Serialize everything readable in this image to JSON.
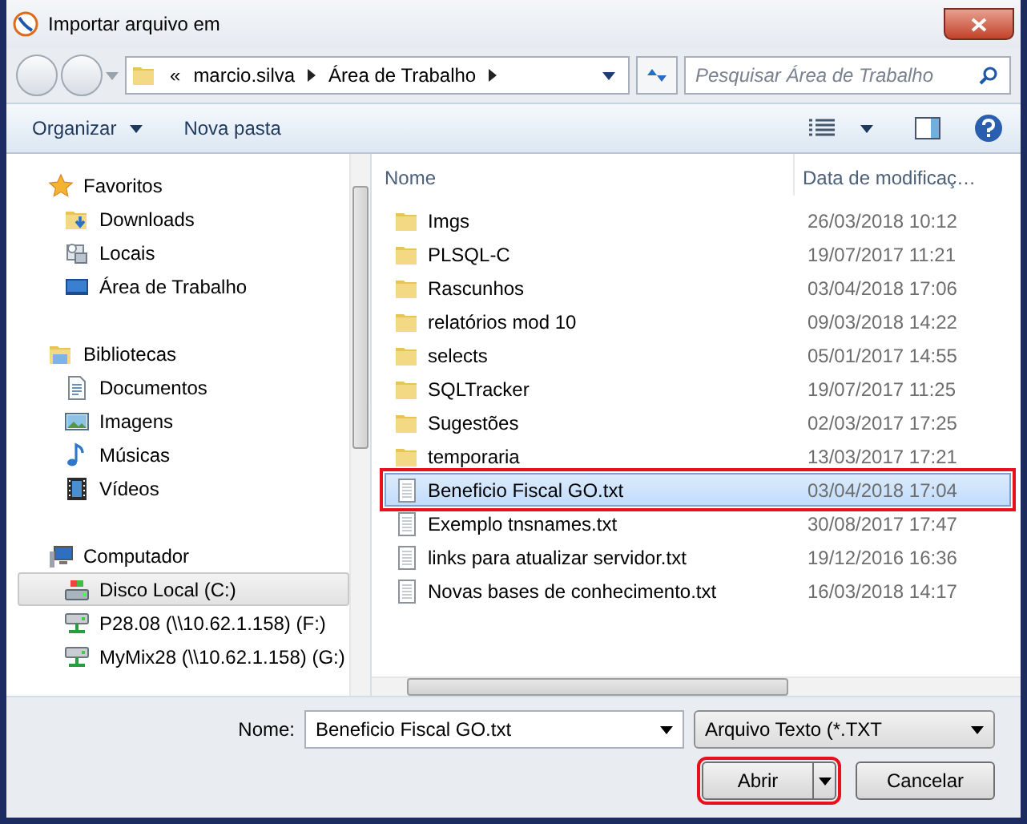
{
  "window": {
    "title": "Importar arquivo em"
  },
  "address": {
    "crumbs": [
      "«",
      "marcio.silva",
      "Área de Trabalho"
    ]
  },
  "search": {
    "placeholder": "Pesquisar Área de Trabalho"
  },
  "toolbar": {
    "organize": "Organizar",
    "new_folder": "Nova pasta"
  },
  "sidebar": {
    "groups": [
      {
        "label": "Favoritos",
        "kind": "star",
        "items": [
          {
            "label": "Downloads",
            "kind": "download",
            "selected": false
          },
          {
            "label": "Locais",
            "kind": "places",
            "selected": false
          },
          {
            "label": "Área de Trabalho",
            "kind": "desktop",
            "selected": false
          }
        ]
      },
      {
        "label": "Bibliotecas",
        "kind": "library",
        "items": [
          {
            "label": "Documentos",
            "kind": "document",
            "selected": false
          },
          {
            "label": "Imagens",
            "kind": "image",
            "selected": false
          },
          {
            "label": "Músicas",
            "kind": "music",
            "selected": false
          },
          {
            "label": "Vídeos",
            "kind": "video",
            "selected": false
          }
        ]
      },
      {
        "label": "Computador",
        "kind": "computer",
        "items": [
          {
            "label": "Disco Local (C:)",
            "kind": "disk",
            "selected": true
          },
          {
            "label": "P28.08 (\\\\10.62.1.158) (F:)",
            "kind": "network",
            "selected": false
          },
          {
            "label": "MyMix28 (\\\\10.62.1.158) (G:)",
            "kind": "network",
            "selected": false
          }
        ]
      }
    ]
  },
  "columns": [
    "Nome",
    "Data de modificaç…"
  ],
  "files": [
    {
      "name": "Imgs",
      "date": "26/03/2018 10:12",
      "kind": "folder",
      "selected": false,
      "annotated": false
    },
    {
      "name": "PLSQL-C",
      "date": "19/07/2017 11:21",
      "kind": "folder",
      "selected": false,
      "annotated": false
    },
    {
      "name": "Rascunhos",
      "date": "03/04/2018 17:06",
      "kind": "folder",
      "selected": false,
      "annotated": false
    },
    {
      "name": "relatórios mod 10",
      "date": "09/03/2018 14:22",
      "kind": "folder",
      "selected": false,
      "annotated": false
    },
    {
      "name": "selects",
      "date": "05/01/2017 14:55",
      "kind": "folder",
      "selected": false,
      "annotated": false
    },
    {
      "name": "SQLTracker",
      "date": "19/07/2017 11:25",
      "kind": "folder",
      "selected": false,
      "annotated": false
    },
    {
      "name": "Sugestões",
      "date": "02/03/2017 17:25",
      "kind": "folder",
      "selected": false,
      "annotated": false
    },
    {
      "name": "temporaria",
      "date": "13/03/2017 17:21",
      "kind": "folder",
      "selected": false,
      "annotated": false
    },
    {
      "name": "Beneficio Fiscal GO.txt",
      "date": "03/04/2018 17:04",
      "kind": "text",
      "selected": true,
      "annotated": true
    },
    {
      "name": "Exemplo tnsnames.txt",
      "date": "30/08/2017 17:47",
      "kind": "text",
      "selected": false,
      "annotated": false
    },
    {
      "name": "links para atualizar servidor.txt",
      "date": "19/12/2016 16:36",
      "kind": "text",
      "selected": false,
      "annotated": false
    },
    {
      "name": "Novas bases de conhecimento.txt",
      "date": "16/03/2018 14:17",
      "kind": "text",
      "selected": false,
      "annotated": false
    }
  ],
  "footer": {
    "name_label": "Nome:",
    "name_value": "Beneficio Fiscal GO.txt",
    "filter": "Arquivo Texto (*.TXT",
    "open": {
      "label": "Abrir",
      "annotated": true
    },
    "cancel": {
      "label": "Cancelar",
      "annotated": false
    }
  }
}
